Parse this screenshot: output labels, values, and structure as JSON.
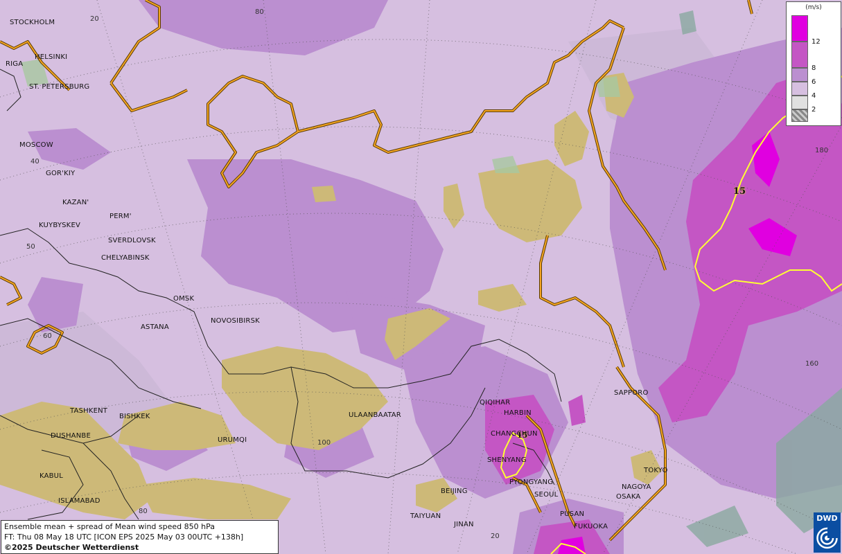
{
  "map": {
    "colors": {
      "level_2": "#c8c8c8",
      "level_4": "#d6bfe0",
      "level_6": "#bb8fd0",
      "level_8": "#c456c4",
      "level_12": "#e000e0",
      "terrain": "#cdb978",
      "coast": "#f5a623",
      "contour": "#ffff33"
    },
    "cities": [
      {
        "name": "STOCKHOLM"
      },
      {
        "name": "HELSINKI"
      },
      {
        "name": "RIGA"
      },
      {
        "name": "ST. PETERSBURG"
      },
      {
        "name": "MOSCOW"
      },
      {
        "name": "GOR'KIY"
      },
      {
        "name": "KAZAN'"
      },
      {
        "name": "PERM'"
      },
      {
        "name": "KUYBYSKEV"
      },
      {
        "name": "SVERDLOVSK"
      },
      {
        "name": "CHELYABINSK"
      },
      {
        "name": "OMSK"
      },
      {
        "name": "NOVOSIBIRSK"
      },
      {
        "name": "ASTANA"
      },
      {
        "name": "TASHKENT"
      },
      {
        "name": "BISHKEK"
      },
      {
        "name": "DUSHANBE"
      },
      {
        "name": "URUMQI"
      },
      {
        "name": "ULAANBAATAR"
      },
      {
        "name": "KABUL"
      },
      {
        "name": "ISLAMABAD"
      },
      {
        "name": "QIQIHAR"
      },
      {
        "name": "HARBIN"
      },
      {
        "name": "CHANGCHUN"
      },
      {
        "name": "SHENYANG"
      },
      {
        "name": "BEIJING"
      },
      {
        "name": "PYONGYANG"
      },
      {
        "name": "SEOUL"
      },
      {
        "name": "TAIYUAN"
      },
      {
        "name": "JINAN"
      },
      {
        "name": "PUSAN"
      },
      {
        "name": "FUKUOKA"
      },
      {
        "name": "OSAKA"
      },
      {
        "name": "NAGOYA"
      },
      {
        "name": "TOKYO"
      },
      {
        "name": "SAPPORO"
      }
    ],
    "grid_labels": [
      "20",
      "80",
      "40",
      "50",
      "60",
      "100",
      "80",
      "20",
      "180",
      "160"
    ],
    "contour_labels": [
      "15",
      "15"
    ]
  },
  "legend": {
    "unit": "(m/s)",
    "ticks": [
      "12",
      "8",
      "6",
      "4",
      "2"
    ]
  },
  "info": {
    "line1": "Ensemble mean + spread of Mean wind speed 850 hPa",
    "line2": "FT: Thu 08 May 18 UTC [ICON EPS 2025 May 03 00UTC +138h]",
    "line3": "©2025 Deutscher Wetterdienst"
  },
  "logo": {
    "text": "DWD"
  }
}
